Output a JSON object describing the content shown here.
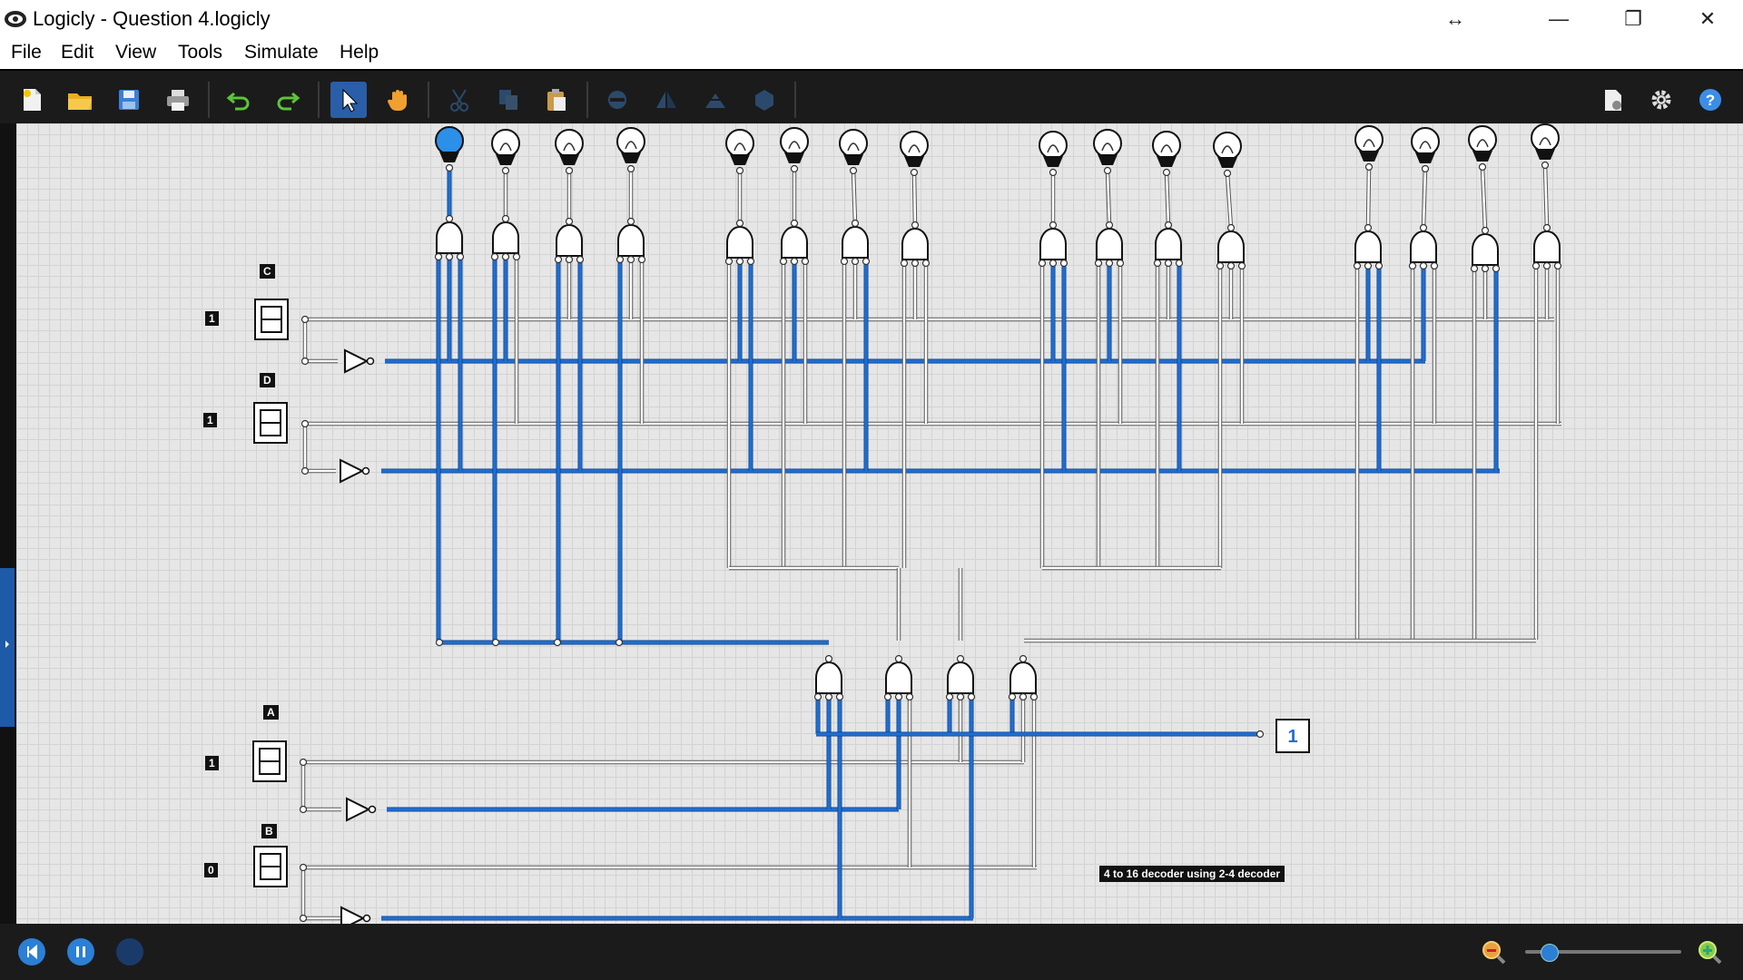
{
  "window": {
    "title": "Logicly - Question 4.logicly",
    "controls": [
      "↔",
      "—",
      "❐",
      "✕"
    ]
  },
  "menu": [
    "File",
    "Edit",
    "View",
    "Tools",
    "Simulate",
    "Help"
  ],
  "toolbar": {
    "buttons": [
      "new-file",
      "open-folder",
      "save",
      "print",
      "undo",
      "redo",
      "select-pointer",
      "pan-hand",
      "cut",
      "copy",
      "paste",
      "rotate",
      "flip-horizontal",
      "flip-vertical",
      "group"
    ],
    "right_buttons": [
      "export",
      "settings",
      "help"
    ]
  },
  "circuit": {
    "inputs": [
      {
        "name": "C",
        "value": "1"
      },
      {
        "name": "D",
        "value": "1"
      },
      {
        "name": "A",
        "value": "1"
      },
      {
        "name": "B",
        "value": "0"
      }
    ],
    "bulbs_on": [
      true,
      false,
      false,
      false,
      false,
      false,
      false,
      false,
      false,
      false,
      false,
      false,
      false,
      false,
      false,
      false
    ],
    "output_probe": "1",
    "note": "4 to 16 decoder using 2-4 decoder",
    "wire_active_color": "#1f6fd0",
    "wire_inactive_color": "#ffffff"
  },
  "statusbar": {
    "zoom_level": 0.15
  }
}
